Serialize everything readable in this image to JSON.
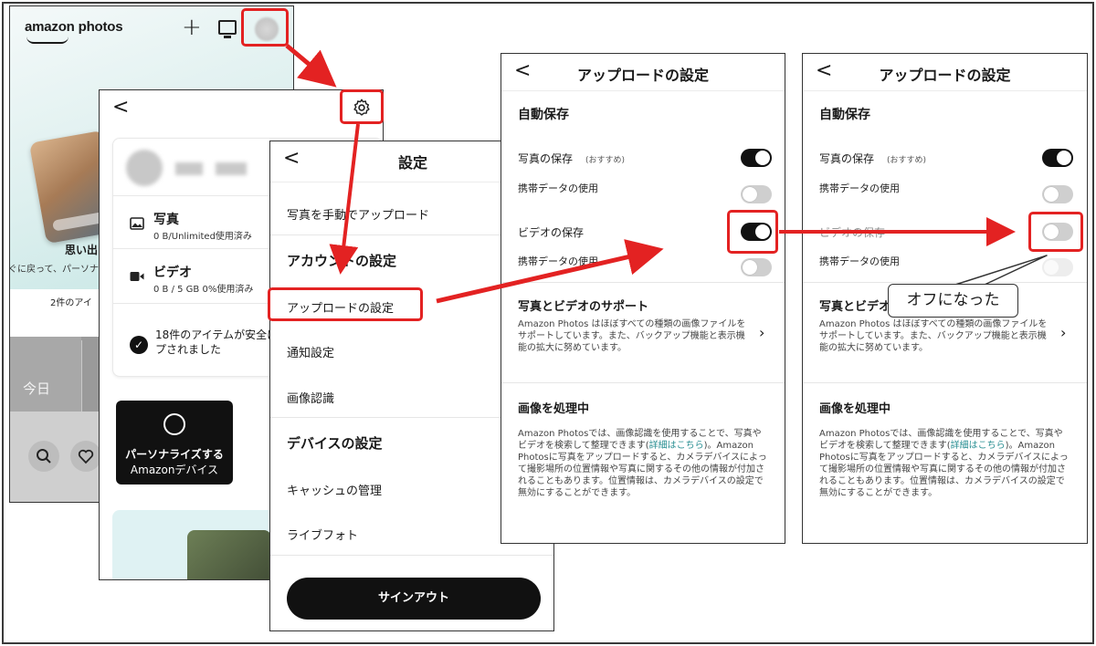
{
  "screen_home": {
    "logo": "amazon photos",
    "plus_label": "+",
    "memories_title": "思い出",
    "memories_sub": "ぐに戻って、パーソナ",
    "item_count": "2件のアイ",
    "today_tab": "今日"
  },
  "screen_account": {
    "back": "<",
    "photos_title": "写真",
    "photos_sub": "0 B/Unlimited使用済み",
    "video_title": "ビデオ",
    "video_sub": "0 B / 5 GB  0%使用済み",
    "backup_msg": "18件のアイテムが安全にバックアップされました",
    "check": "✓",
    "alexa_line1": "パーソナライズする",
    "alexa_line2": "Amazonデバイス"
  },
  "screen_settings": {
    "back": "<",
    "title": "設定",
    "manual_upload": "写真を手動でアップロード",
    "account_section": "アカウントの設定",
    "upload_settings": "アップロードの設定",
    "notification": "通知設定",
    "image_recognition": "画像認識",
    "device_section": "デバイスの設定",
    "cache": "キャッシュの管理",
    "live_photo": "ライブフォト",
    "signout": "サインアウト"
  },
  "upload_before": {
    "back": "<",
    "title": "アップロードの設定",
    "auto_save": "自動保存",
    "photo_save": "写真の保存",
    "recommended": "(おすすめ)",
    "mobile_data_1": "携帯データの使用",
    "video_save": "ビデオの保存",
    "mobile_data_2": "携帯データの使用",
    "support_title": "写真とビデオのサポート",
    "support_body": "Amazon Photos はほぼすべての種類の画像ファイルをサポートしています。また、バックアップ機能と表示機能の拡大に努めています。",
    "chevron": "›",
    "processing_title": "画像を処理中",
    "processing_body_a": "Amazon Photosでは、画像認識を使用することで、写真やビデオを検索して整理できます(",
    "processing_link": "詳細はこちら",
    "processing_body_b": ")。Amazon Photosに写真をアップロードすると、カメラデバイスによって撮影場所の位置情報や写真に関するその他の情報が付加されることもあります。位置情報は、カメラデバイスの設定で無効にすることができます。",
    "toggles": {
      "photo_save": true,
      "mobile_data_1": false,
      "video_save": true,
      "mobile_data_2": false
    }
  },
  "upload_after": {
    "back": "<",
    "title": "アップロードの設定",
    "auto_save": "自動保存",
    "photo_save": "写真の保存",
    "recommended": "(おすすめ)",
    "mobile_data_1": "携帯データの使用",
    "video_save": "ビデオの保存",
    "mobile_data_2": "携帯データの使用",
    "support_title": "写真とビデオのサポート",
    "support_body": "Amazon Photos はほぼすべての種類の画像ファイルをサポートしています。また、バックアップ機能と表示機能の拡大に努めています。",
    "chevron": "›",
    "processing_title": "画像を処理中",
    "processing_body_a": "Amazon Photosでは、画像認識を使用することで、写真やビデオを検索して整理できます(",
    "processing_link": "詳細はこちら",
    "processing_body_b": ")。Amazon Photosに写真をアップロードすると、カメラデバイスによって撮影場所の位置情報や写真に関するその他の情報が付加されることもあります。位置情報は、カメラデバイスの設定で無効にすることができます。",
    "toggles": {
      "photo_save": true,
      "mobile_data_1": false,
      "video_save": false,
      "mobile_data_2": false
    }
  },
  "callout": "オフになった",
  "colors": {
    "highlight": "#e32222",
    "link": "#2a8f93",
    "toggle_on": "#111111",
    "toggle_off": "#cfcfcf"
  }
}
